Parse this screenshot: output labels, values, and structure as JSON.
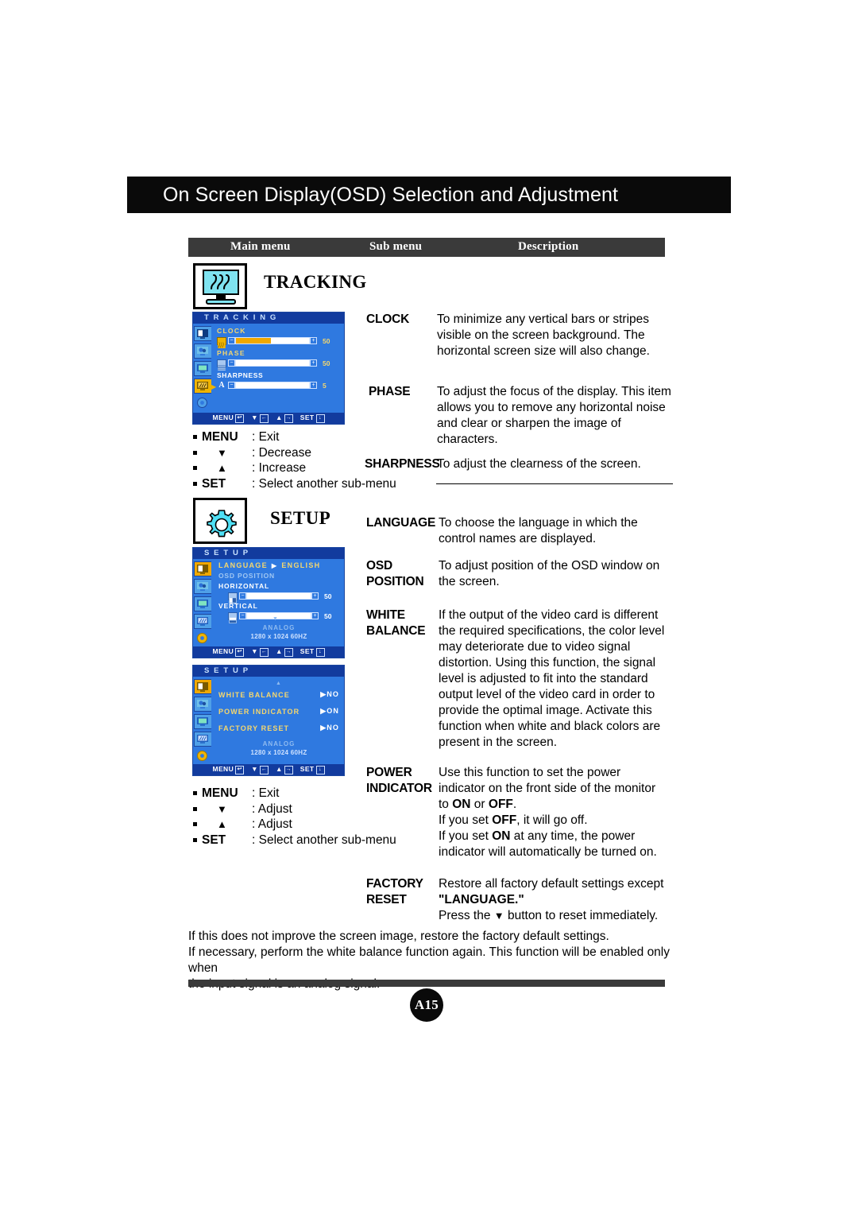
{
  "header": {
    "title": "On Screen Display(OSD) Selection and Adjustment"
  },
  "table_header": {
    "main_menu": "Main menu",
    "sub_menu": "Sub menu",
    "description": "Description"
  },
  "sections": [
    {
      "id": "tracking",
      "menu_title": "TRACKING",
      "icon": "monitor-tracking-icon",
      "osd": {
        "title": "T R A C K I N G",
        "rows": [
          {
            "label": "CLOCK",
            "value": "50",
            "fill_pct": 48,
            "selected": true
          },
          {
            "label": "PHASE",
            "value": "50",
            "fill_pct": 0,
            "selected": false
          },
          {
            "label": "SHARPNESS",
            "value": "5",
            "fill_pct": 0,
            "selected": false,
            "glyph": "A"
          }
        ],
        "footer": {
          "menu": "MENU",
          "down": "▼",
          "up": "▲",
          "set": "SET"
        }
      },
      "legend": [
        {
          "key": "MENU",
          "sym": "",
          "text": ": Exit"
        },
        {
          "key": "",
          "sym": "▼",
          "text": ": Decrease"
        },
        {
          "key": "",
          "sym": "▲",
          "text": ": Increase"
        },
        {
          "key": "SET",
          "sym": "",
          "text": ": Select another sub-menu"
        }
      ],
      "items": [
        {
          "sub": "CLOCK",
          "desc": "To minimize any vertical bars or stripes visible on the screen background. The horizontal screen size will also change."
        },
        {
          "sub": "PHASE",
          "desc": "To adjust the focus of the display. This item allows you to remove any horizontal noise and clear or sharpen the image of characters."
        },
        {
          "sub": "SHARPNESS",
          "desc": "To adjust the clearness of the screen."
        }
      ]
    },
    {
      "id": "setup",
      "menu_title": "SETUP",
      "icon": "gear-setup-icon",
      "osd1": {
        "title": "S E T U P",
        "language_label": "LANGUAGE",
        "language_value": "ENGLISH",
        "osd_position_label": "OSD POSITION",
        "rows": [
          {
            "label": "HORIZONTAL",
            "value": "50",
            "fill_pct": 0
          },
          {
            "label": "VERTICAL",
            "value": "50",
            "fill_pct": 0
          }
        ],
        "analog": "ANALOG",
        "resolution": "1280 x 1024 60HZ",
        "footer": {
          "menu": "MENU",
          "down": "▼",
          "up": "▲",
          "set": "SET"
        }
      },
      "osd2": {
        "title": "S E T U P",
        "options": [
          {
            "label": "WHITE BALANCE",
            "value": "NO"
          },
          {
            "label": "POWER INDICATOR",
            "value": "ON"
          },
          {
            "label": "FACTORY RESET",
            "value": "NO"
          }
        ],
        "analog": "ANALOG",
        "resolution": "1280 x 1024 60HZ",
        "footer": {
          "menu": "MENU",
          "down": "▼",
          "up": "▲",
          "set": "SET"
        }
      },
      "legend": [
        {
          "key": "MENU",
          "sym": "",
          "text": ": Exit"
        },
        {
          "key": "",
          "sym": "▼",
          "text": ": Adjust"
        },
        {
          "key": "",
          "sym": "▲",
          "text": ": Adjust"
        },
        {
          "key": "SET",
          "sym": "",
          "text": ": Select another sub-menu"
        }
      ],
      "items": [
        {
          "sub": "LANGUAGE",
          "desc": "To choose the language in which the control names are displayed."
        },
        {
          "sub_line1": "OSD",
          "sub_line2": "POSITION",
          "desc": "To adjust position of the OSD window on the screen."
        },
        {
          "sub_line1": "WHITE",
          "sub_line2": "BALANCE",
          "desc": "If the output of the video card is different the required specifications, the color level may deteriorate due to video signal distortion. Using this function, the signal level is adjusted to fit into the standard output level of the video card in order to provide the optimal image. Activate this function when white and black colors are present in the screen."
        },
        {
          "sub_line1": "POWER",
          "sub_line2": "INDICATOR",
          "desc_l1": "Use this function to set the power",
          "desc_l2": "indicator on the front side of the monitor",
          "desc_l3_a": "to ",
          "desc_l3_b": "ON",
          "desc_l3_c": " or ",
          "desc_l3_d": "OFF",
          "desc_l3_e": ".",
          "desc_l4_a": "If you set ",
          "desc_l4_b": "OFF",
          "desc_l4_c": ", it will go off.",
          "desc_l5_a": "If you set ",
          "desc_l5_b": "ON",
          "desc_l5_c": " at any time, the power",
          "desc_l6": "indicator will automatically be turned on."
        },
        {
          "sub_line1": "FACTORY",
          "sub_line2": "RESET",
          "desc_l1": "Restore all factory default settings except",
          "desc_l2": "\"LANGUAGE.\"",
          "desc_l3_a": "Press the ",
          "desc_l3_b": "▼",
          "desc_l3_c": " button to reset immediately."
        }
      ]
    }
  ],
  "footnote": {
    "line1": "If this does not improve the screen image, restore the factory default settings.",
    "line2": "If necessary, perform the white balance function again. This function will be enabled only when",
    "line3": "the input signal is an analog signal."
  },
  "page_number": "A15",
  "colors": {
    "banner_bg": "#0a0a0a",
    "table_header_bg": "#3a3a3a",
    "osd_blue": "#2f79e0",
    "osd_title_blue": "#123b9e",
    "osd_yellow": "#f5d76e",
    "osd_amber": "#f0a800"
  }
}
